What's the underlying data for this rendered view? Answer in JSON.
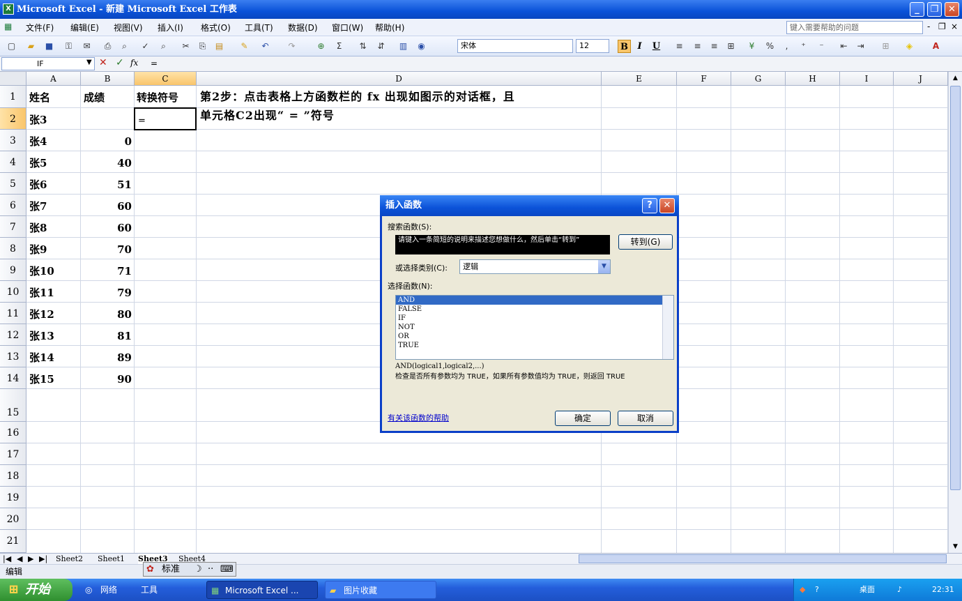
{
  "window": {
    "title": "Microsoft Excel - 新建 Microsoft Excel 工作表",
    "app_icon": "X"
  },
  "menu": {
    "items": [
      "文件(F)",
      "编辑(E)",
      "视图(V)",
      "插入(I)",
      "格式(O)",
      "工具(T)",
      "数据(D)",
      "窗口(W)",
      "帮助(H)"
    ],
    "help_placeholder": "键入需要帮助的问题"
  },
  "toolbar": {
    "font_name": "宋体",
    "font_size": "12",
    "bold": "B",
    "italic": "I",
    "underline": "U",
    "percent": "%",
    "sum": "Σ"
  },
  "formula_bar": {
    "name_box": "IF",
    "formula": "="
  },
  "sheet": {
    "columns": [
      "A",
      "B",
      "C",
      "D",
      "E",
      "F",
      "G",
      "H",
      "I",
      "J"
    ],
    "selected_column": "C",
    "rows": [
      "1",
      "2",
      "3",
      "4",
      "5",
      "6",
      "7",
      "8",
      "9",
      "10",
      "11",
      "12",
      "13",
      "14",
      "15",
      "16",
      "17",
      "18",
      "19",
      "20",
      "21"
    ],
    "selected_row": "2",
    "headers": {
      "a": "姓名",
      "b": "成绩",
      "c": "转换符号"
    },
    "data": [
      {
        "name": "张3",
        "score": ""
      },
      {
        "name": "张4",
        "score": "0"
      },
      {
        "name": "张5",
        "score": "40"
      },
      {
        "name": "张6",
        "score": "51"
      },
      {
        "name": "张7",
        "score": "60"
      },
      {
        "name": "张8",
        "score": "60"
      },
      {
        "name": "张9",
        "score": "70"
      },
      {
        "name": "张10",
        "score": "71"
      },
      {
        "name": "张11",
        "score": "79"
      },
      {
        "name": "张12",
        "score": "80"
      },
      {
        "name": "张13",
        "score": "81"
      },
      {
        "name": "张14",
        "score": "89"
      },
      {
        "name": "张15",
        "score": "90"
      }
    ],
    "active_cell_value": "=",
    "note_line1": "第2步：点击表格上方函数栏的 fx 出现如图示的对话框，且",
    "note_line2": "单元格C2出现“ = ”符号"
  },
  "tabs": [
    "Sheet2",
    "Sheet1",
    "Sheet3",
    "Sheet4"
  ],
  "status": {
    "mode": "编辑",
    "ime_label": "标准"
  },
  "dialog": {
    "title": "插入函数",
    "search_label": "搜索函数(S):",
    "search_text": "请键入一条简短的说明来描述您想做什么，然后单击“转到”",
    "go_button": "转到(G)",
    "category_label": "或选择类别(C):",
    "category_value": "逻辑",
    "select_label": "选择函数(N):",
    "functions": [
      "AND",
      "FALSE",
      "IF",
      "NOT",
      "OR",
      "TRUE"
    ],
    "selected_function": "AND",
    "signature": "AND(logical1,logical2,...)",
    "description": "检查是否所有参数均为 TRUE，如果所有参数值均为 TRUE，则返回 TRUE",
    "help_link": "有关该函数的帮助",
    "ok_button": "确定",
    "cancel_button": "取消"
  },
  "taskbar": {
    "start": "开始",
    "items": [
      "网络",
      "工具",
      "Microsoft Excel ...",
      "图片收藏"
    ],
    "tray_text": "桌面",
    "clock": "22:31"
  }
}
